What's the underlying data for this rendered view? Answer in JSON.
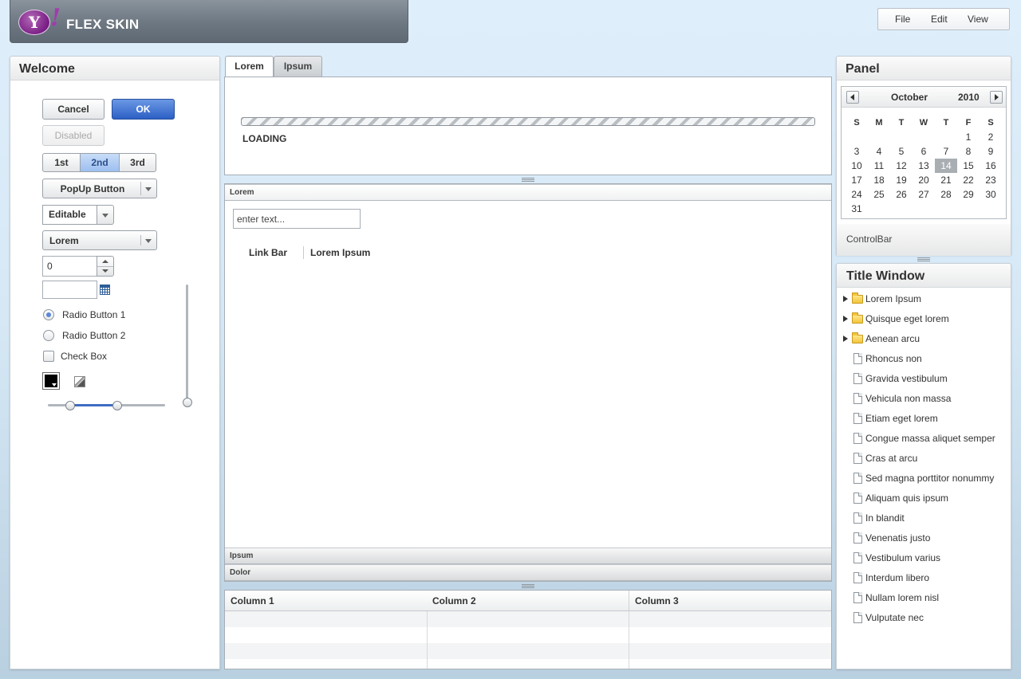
{
  "header": {
    "logo_letter": "Y",
    "logo_bang": "!",
    "title": "FLEX SKIN"
  },
  "menubar": {
    "items": [
      "File",
      "Edit",
      "View"
    ]
  },
  "welcome_panel": {
    "title": "Welcome",
    "cancel_label": "Cancel",
    "ok_label": "OK",
    "disabled_label": "Disabled",
    "segments": [
      "1st",
      "2nd",
      "3rd"
    ],
    "selected_segment": "2nd",
    "popup_button_label": "PopUp Button",
    "editable_combo_value": "Editable",
    "combo_value": "Lorem",
    "stepper_value": "0",
    "date_field_value": "",
    "radio1_label": "Radio Button 1",
    "radio2_label": "Radio Button 2",
    "radio_selected": "Radio Button 1",
    "checkbox_label": "Check Box",
    "checkbox_checked": false,
    "color_picker_value": "#000000",
    "hslider_values": [
      0.2,
      0.6
    ],
    "vslider_value": 0.0
  },
  "tabnav": {
    "tabs": [
      "Lorem",
      "Ipsum"
    ],
    "active_tab": "Lorem",
    "progress_label": "LOADING"
  },
  "accordion": {
    "sections": [
      "Lorem",
      "Ipsum",
      "Dolor"
    ],
    "open_section": "Lorem",
    "text_input_placeholder": "enter text...",
    "linkbar": [
      "Link Bar",
      "Lorem Ipsum"
    ]
  },
  "datagrid": {
    "columns": [
      "Column 1",
      "Column 2",
      "Column 3"
    ]
  },
  "panel": {
    "title": "Panel",
    "calendar": {
      "month": "October",
      "year": "2010",
      "day_headers": [
        "S",
        "M",
        "T",
        "W",
        "T",
        "F",
        "S"
      ],
      "weeks": [
        [
          "",
          "",
          "",
          "",
          "",
          "1",
          "2"
        ],
        [
          "3",
          "4",
          "5",
          "6",
          "7",
          "8",
          "9"
        ],
        [
          "10",
          "11",
          "12",
          "13",
          "14",
          "15",
          "16"
        ],
        [
          "17",
          "18",
          "19",
          "20",
          "21",
          "22",
          "23"
        ],
        [
          "24",
          "25",
          "26",
          "27",
          "28",
          "29",
          "30"
        ],
        [
          "31",
          "",
          "",
          "",
          "",
          "",
          ""
        ]
      ],
      "today": "14"
    },
    "control_bar_label": "ControlBar"
  },
  "title_window": {
    "title": "Title Window",
    "tree": [
      {
        "label": "Lorem Ipsum",
        "type": "folder"
      },
      {
        "label": "Quisque eget lorem",
        "type": "folder"
      },
      {
        "label": "Aenean arcu",
        "type": "folder"
      },
      {
        "label": "Rhoncus non",
        "type": "file"
      },
      {
        "label": "Gravida vestibulum",
        "type": "file"
      },
      {
        "label": "Vehicula non massa",
        "type": "file"
      },
      {
        "label": "Etiam eget lorem",
        "type": "file"
      },
      {
        "label": "Congue massa aliquet semper",
        "type": "file"
      },
      {
        "label": "Cras at arcu",
        "type": "file"
      },
      {
        "label": "Sed magna porttitor nonummy",
        "type": "file"
      },
      {
        "label": "Aliquam quis ipsum",
        "type": "file"
      },
      {
        "label": "In blandit",
        "type": "file"
      },
      {
        "label": "Venenatis justo",
        "type": "file"
      },
      {
        "label": "Vestibulum varius",
        "type": "file"
      },
      {
        "label": "Interdum libero",
        "type": "file"
      },
      {
        "label": "Nullam lorem nisl",
        "type": "file"
      },
      {
        "label": "Vulputate nec",
        "type": "file"
      }
    ]
  },
  "colors": {
    "accent": "#2c5fc5",
    "selected_segment": "#9dbff0",
    "header": "#6d7782"
  }
}
